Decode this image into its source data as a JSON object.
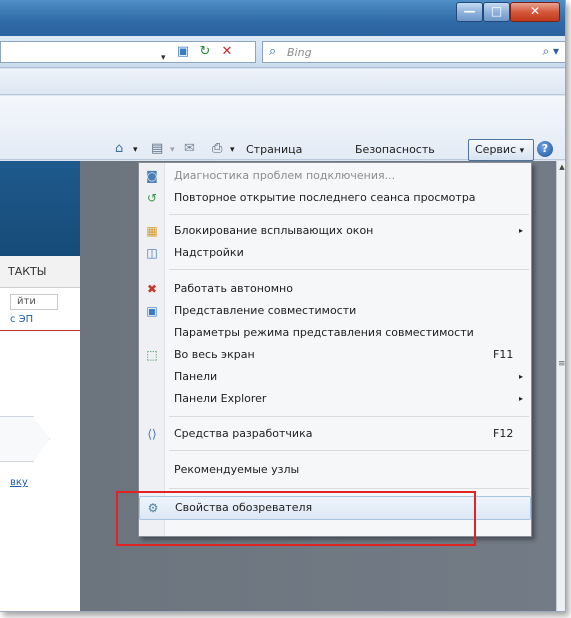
{
  "browser": {
    "caption_buttons": {
      "minimize": "—",
      "maximize": "□",
      "close": "✕"
    },
    "address_bar": {
      "dropdown": "▾",
      "icons": [
        "compat-view-icon",
        "refresh-icon",
        "stop-icon"
      ]
    },
    "search": {
      "placeholder": "Bing",
      "button": "⌕ ▾"
    },
    "command_bar": {
      "page_label": "Страница",
      "safety_label": "Безопасность",
      "tools_label": "Сервис",
      "help_label": "?",
      "dropdown_arrow": "▾"
    }
  },
  "page": {
    "contacts_tab": "ТАКТЫ",
    "login_button": "йти",
    "ep_link": "с ЭП",
    "application_link": "вку"
  },
  "tools_menu": {
    "items": [
      {
        "label": "Диагностика проблем подключения...",
        "icon": "diagnostics-icon",
        "disabled": true
      },
      {
        "label": "Повторное открытие последнего сеанса просмотра",
        "icon": "reopen-session-icon"
      },
      {
        "label": "Блокирование всплывающих окон",
        "icon": "popup-blocker-icon",
        "submenu": true
      },
      {
        "label": "Надстройки",
        "icon": "addons-icon"
      },
      {
        "label": "Работать автономно",
        "icon": "offline-icon"
      },
      {
        "label": "Представление совместимости",
        "icon": "compat-view-icon"
      },
      {
        "label": "Параметры режима представления совместимости",
        "icon": ""
      },
      {
        "label": "Во весь экран",
        "icon": "fullscreen-icon",
        "shortcut": "F11"
      },
      {
        "label": "Панели",
        "icon": "",
        "submenu": true
      },
      {
        "label": "Панели Explorer",
        "icon": "",
        "submenu": true
      },
      {
        "label": "Средства разработчика",
        "icon": "developer-tools-icon",
        "shortcut": "F12"
      },
      {
        "label": "Рекомендуемые узлы",
        "icon": ""
      },
      {
        "label": "Свойства обозревателя",
        "icon": "internet-options-icon",
        "highlighted": true
      }
    ],
    "submenu_arrow": "▸"
  },
  "colors": {
    "titlebar": "#2f6aa7",
    "highlight_frame": "#e02424",
    "site_header": "#1e5a8d",
    "overlay_gray": "#6e7681"
  }
}
